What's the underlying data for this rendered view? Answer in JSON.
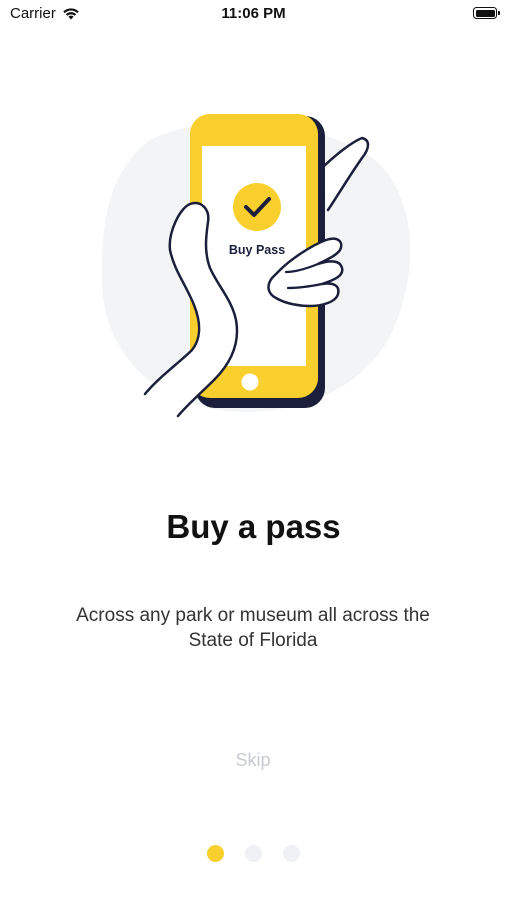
{
  "status_bar": {
    "carrier": "Carrier",
    "time": "11:06 PM"
  },
  "illustration": {
    "button_label": "Buy Pass",
    "icons": [
      "hand-holding-phone-illustration",
      "checkmark-icon"
    ]
  },
  "onboarding": {
    "title": "Buy a pass",
    "subtitle_line1": "Across any park or museum all across the",
    "subtitle_line2": "State of Florida",
    "skip_label": "Skip"
  },
  "pagination": {
    "total": 3,
    "active_index": 0
  },
  "colors": {
    "accent": "#f8cf2c",
    "outline": "#1b1f3b",
    "blob": "#f3f4f6",
    "skip": "#c9cbd2",
    "dot_inactive": "#f0f1f4"
  }
}
